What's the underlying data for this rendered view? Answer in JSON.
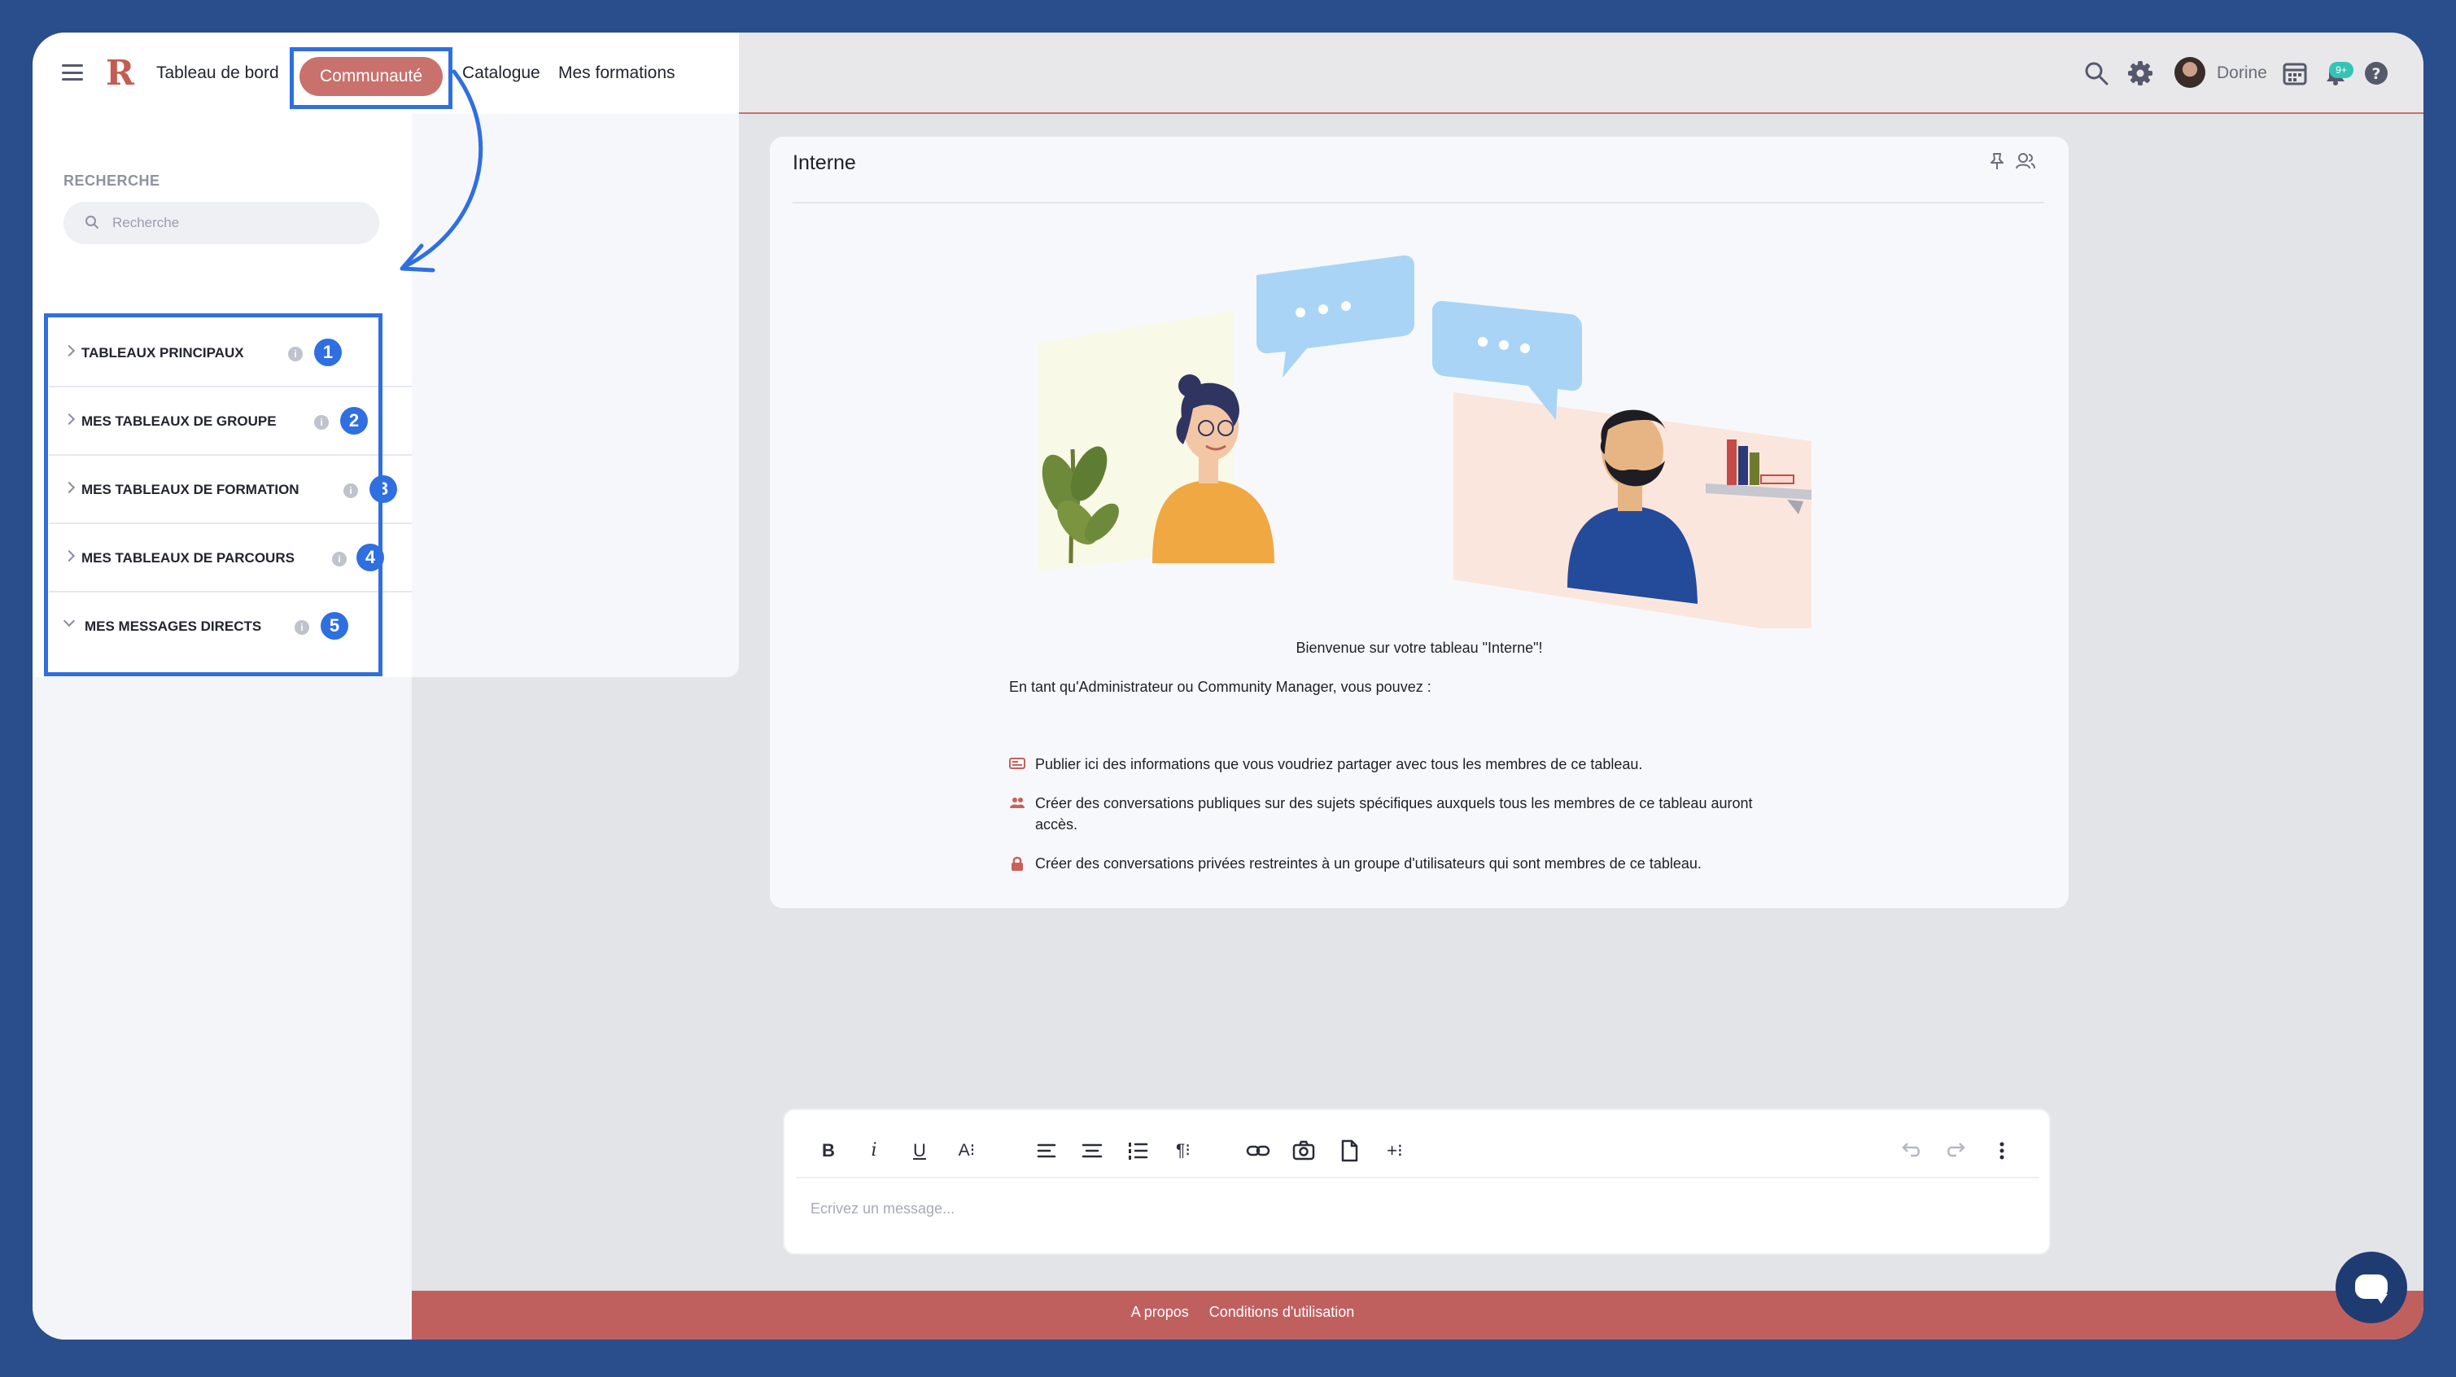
{
  "header": {
    "logo": "R",
    "nav": {
      "dashboard": "Tableau de bord",
      "community": "Communauté",
      "catalogue": "Catalogue",
      "trainings": "Mes formations"
    },
    "user_name": "Dorine",
    "notification_badge": "9+"
  },
  "sidebar": {
    "search_label": "RECHERCHE",
    "search_placeholder": "Recherche",
    "sections": [
      {
        "label": "TABLEAUX PRINCIPAUX",
        "number": "1",
        "expanded": false
      },
      {
        "label": "MES TABLEAUX DE GROUPE",
        "number": "2",
        "expanded": false
      },
      {
        "label": "MES TABLEAUX DE FORMATION",
        "number": "3",
        "expanded": false
      },
      {
        "label": "MES TABLEAUX DE PARCOURS",
        "number": "4",
        "expanded": false
      },
      {
        "label": "MES MESSAGES DIRECTS",
        "number": "5",
        "expanded": true
      }
    ],
    "info_glyph": "i"
  },
  "board": {
    "title": "Interne",
    "welcome": "Bienvenue sur votre tableau \"Interne\"!",
    "intro": "En tant qu'Administrateur ou Community Manager, vous pouvez :",
    "bullets": [
      {
        "icon": "announcement-icon",
        "text": "Publier ici des informations que vous voudriez partager avec tous les membres de ce tableau."
      },
      {
        "icon": "group-icon",
        "text": "Créer des conversations publiques sur des sujets spécifiques auxquels tous les membres de ce tableau auront accès."
      },
      {
        "icon": "lock-icon",
        "text": "Créer des conversations privées restreintes à un groupe d'utilisateurs qui sont membres de ce tableau."
      }
    ]
  },
  "editor": {
    "placeholder": "Ecrivez un message...",
    "tools": {
      "bold": "B",
      "italic": "i",
      "underline": "U",
      "text_size": "A⁝",
      "paragraph": "¶⁝",
      "insert": "+⁝"
    }
  },
  "footer": {
    "about": "A propos",
    "terms": "Conditions d'utilisation"
  },
  "colors": {
    "brand": "#c9716c",
    "highlight": "#2f6fe0",
    "footer": "#c0605e",
    "chat_button": "#1f3c72"
  }
}
